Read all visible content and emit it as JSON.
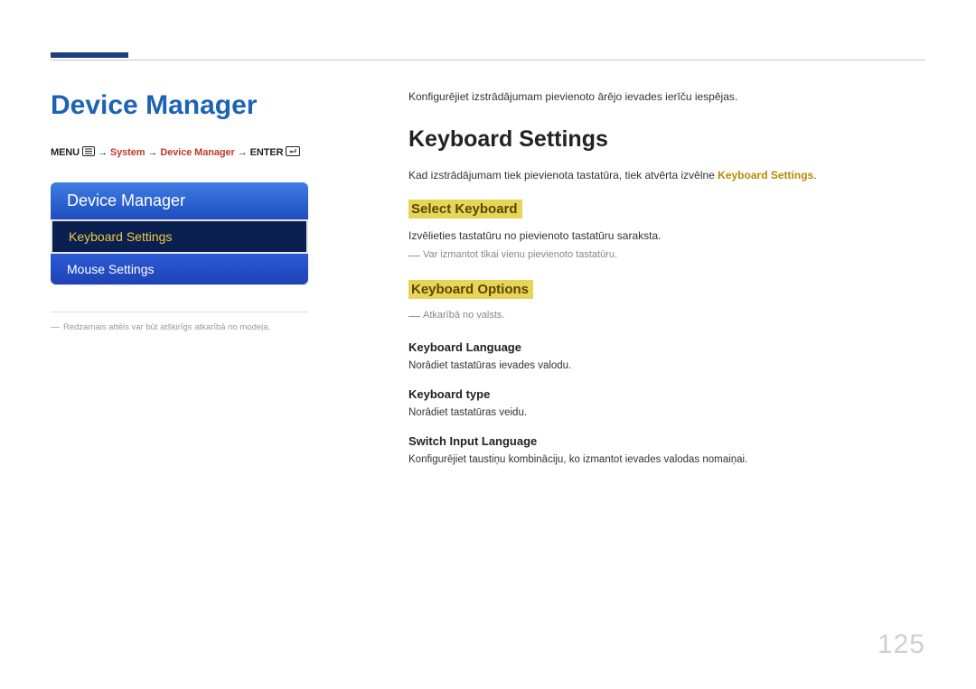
{
  "page": {
    "number": "125",
    "title": "Device Manager"
  },
  "breadcrumb": {
    "menu": "MENU",
    "arrow": "→",
    "system": "System",
    "device_manager": "Device Manager",
    "enter": "ENTER"
  },
  "panel": {
    "header": "Device Manager",
    "items": [
      {
        "label": "Keyboard Settings",
        "active": true
      },
      {
        "label": "Mouse Settings",
        "active": false
      }
    ]
  },
  "left_disclaimer": "Redzamais attēls var būt atšķirīgs atkarībā no modeļa.",
  "content": {
    "intro": "Konfigurējiet izstrādājumam pievienoto ārējo ievades ierīču iespējas.",
    "h2": "Keyboard Settings",
    "body_prefix": "Kad izstrādājumam tiek pievienota tastatūra, tiek atvērta izvēlne ",
    "body_hl": "Keyboard Settings",
    "body_suffix": ".",
    "select_keyboard": {
      "heading": "Select Keyboard",
      "text": "Izvēlieties tastatūru no pievienoto tastatūru saraksta.",
      "note": "Var izmantot tikai vienu pievienoto tastatūru."
    },
    "keyboard_options": {
      "heading": "Keyboard Options",
      "note": "Atkarībā no valsts.",
      "items": [
        {
          "title": "Keyboard Language",
          "text": "Norādiet tastatūras ievades valodu."
        },
        {
          "title": "Keyboard type",
          "text": "Norādiet tastatūras veidu."
        },
        {
          "title": "Switch Input Language",
          "text": "Konfigurējiet taustiņu kombināciju, ko izmantot ievades valodas nomaiņai."
        }
      ]
    }
  }
}
